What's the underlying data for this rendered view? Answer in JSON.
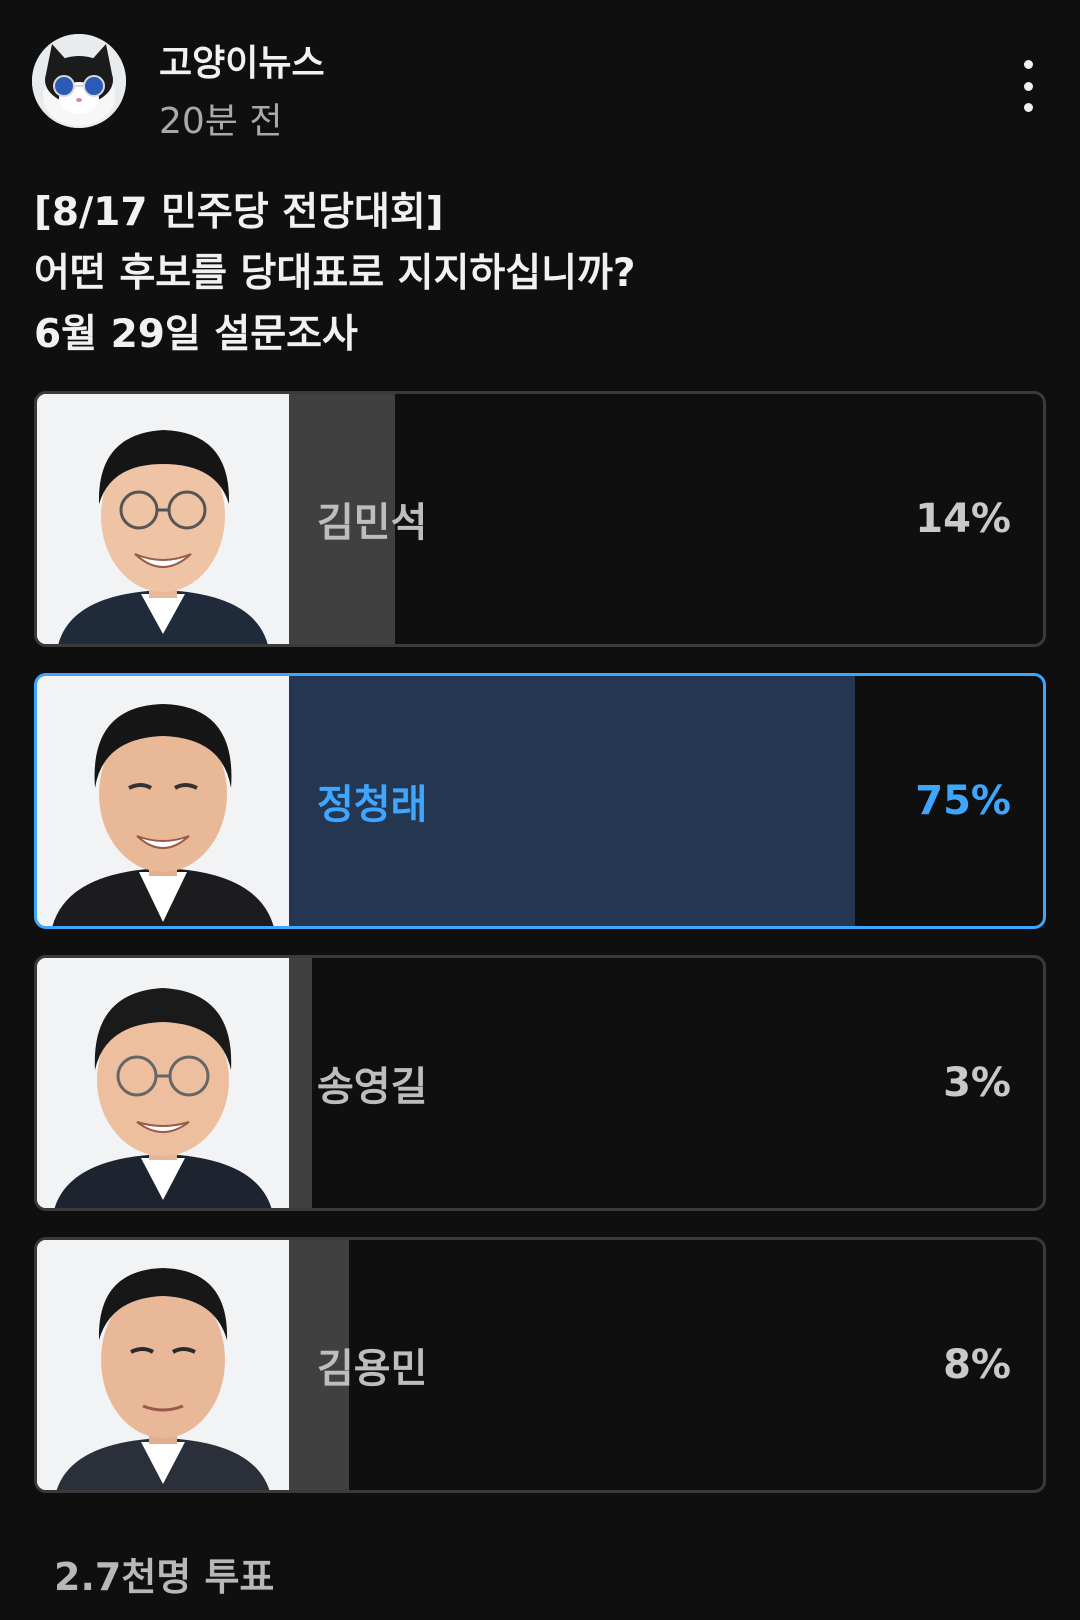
{
  "post": {
    "channel_name": "고양이뉴스",
    "timestamp": "20분 전",
    "avatar_icon": "cat-with-sunglasses-avatar",
    "more_icon": "more-vertical-icon"
  },
  "poll": {
    "question_lines": [
      "[8/17 민주당 전당대회]",
      "어떤 후보를 당대표로 지지하십니까?",
      "6월 29일 설문조사"
    ],
    "options": [
      {
        "name": "김민석",
        "percent_label": "14%",
        "percent": 14,
        "selected": false
      },
      {
        "name": "정청래",
        "percent_label": "75%",
        "percent": 75,
        "selected": true
      },
      {
        "name": "송영길",
        "percent_label": "3%",
        "percent": 3,
        "selected": false
      },
      {
        "name": "김용민",
        "percent_label": "8%",
        "percent": 8,
        "selected": false
      }
    ],
    "vote_count": "2.7천명 투표"
  },
  "colors": {
    "background": "#0f0f10",
    "selected_accent": "#3ea6ff",
    "selected_bar": "#243650",
    "bar": "#404040"
  }
}
